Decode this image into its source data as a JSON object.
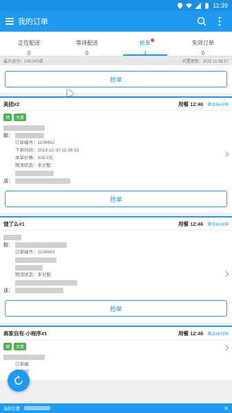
{
  "statusbar": {
    "time": "11:39"
  },
  "appbar": {
    "title": "我的订单",
    "menu_icon": "hamburger-icon",
    "search_icon": "search-icon",
    "more_icon": "more-vertical-icon"
  },
  "tabs": [
    {
      "label": "正在配送",
      "count": "0"
    },
    {
      "label": "等待配送",
      "count": "0"
    },
    {
      "label": "抢单",
      "count": "4"
    },
    {
      "label": "失效订单",
      "count": "0"
    }
  ],
  "infobar": {
    "capacity": "最大运力：100,000单",
    "updated": "位置更新：30日 11:38:57"
  },
  "grab_label": "抢单",
  "cards": [
    {
      "name": "美团#2",
      "meal": "用餐 12:46",
      "remain": "剩余66分钟",
      "tags": [
        "预",
        "大单"
      ],
      "pickup": "取：",
      "deliver": "送：",
      "details": [
        "订单编号：1106692",
        "下单时间：2019-12-30 11:38:33",
        "本单价格：316.5元",
        "物流状态：未分配"
      ]
    },
    {
      "name": "饿了么#1",
      "meal": "用餐 12:46",
      "remain": "剩余66分钟",
      "tags": [],
      "pickup": "取：",
      "deliver": "送：",
      "details": [
        "订单编号：1106693",
        "物流状态：未分配"
      ]
    },
    {
      "name": "商家自有-小程序#1",
      "meal": "用餐 12:46",
      "remain": "剩余66分钟",
      "tags": [
        "预",
        "大单"
      ],
      "details": [
        "订单编",
        "下单时"
      ]
    }
  ],
  "bottombar": {
    "label": "当前位置"
  }
}
